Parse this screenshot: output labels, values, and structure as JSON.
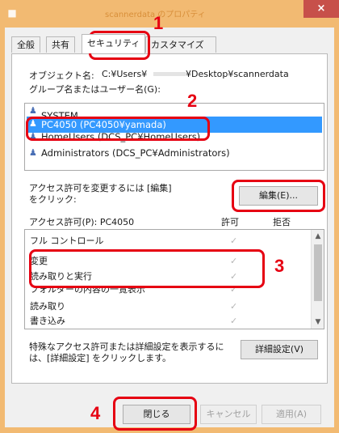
{
  "window": {
    "title_icon": "folder-icon",
    "title_text": "scannerdata のプロパティ",
    "close_label": "×"
  },
  "tabs": [
    {
      "label": "全般"
    },
    {
      "label": "共有"
    },
    {
      "label": "セキュリティ"
    },
    {
      "label": "カスタマイズ"
    }
  ],
  "object": {
    "label": "オブジェクト名:",
    "path_prefix": "C:¥Users¥",
    "path_suffix": "¥Desktop¥scannerdata"
  },
  "group_label": "グループ名またはユーザー名(G):",
  "users": [
    {
      "name": "SYSTEM",
      "icon": "group-icon"
    },
    {
      "name": "PC4050 (PC4050¥yamada)",
      "icon": "user-icon",
      "selected": true
    },
    {
      "name": "HomeUsers (DCS_PC¥HomeUsers)",
      "icon": "group-icon"
    },
    {
      "name": "Administrators (DCS_PC¥Administrators)",
      "icon": "group-icon"
    }
  ],
  "edit_hint_line1": "アクセス許可を変更するには [編集]",
  "edit_hint_line2": "をクリック:",
  "edit_button": "編集(E)...",
  "permissions": {
    "header_label": "アクセス許可(P): PC4050",
    "allow_label": "許可",
    "deny_label": "拒否",
    "check_glyph": "✓",
    "rows": [
      {
        "name": "フル コントロール",
        "allow": true
      },
      {
        "name": "変更",
        "allow": true
      },
      {
        "name": "読み取りと実行",
        "allow": true
      },
      {
        "name": "フォルダーの内容の一覧表示",
        "allow": true
      },
      {
        "name": "読み取り",
        "allow": true
      },
      {
        "name": "書き込み",
        "allow": true
      }
    ]
  },
  "advanced_hint_line1": "特殊なアクセス許可または詳細設定を表示するに",
  "advanced_hint_line2": "は、[詳細設定] をクリックします。",
  "advanced_button": "詳細設定(V)",
  "footer": {
    "close": "閉じる",
    "cancel": "キャンセル",
    "apply": "適用(A)"
  },
  "callouts": [
    "1",
    "2",
    "3",
    "4"
  ],
  "colors": {
    "accent": "#f2ba72",
    "highlight": "#e60012",
    "selection": "#3399ff",
    "close": "#c7504a"
  }
}
